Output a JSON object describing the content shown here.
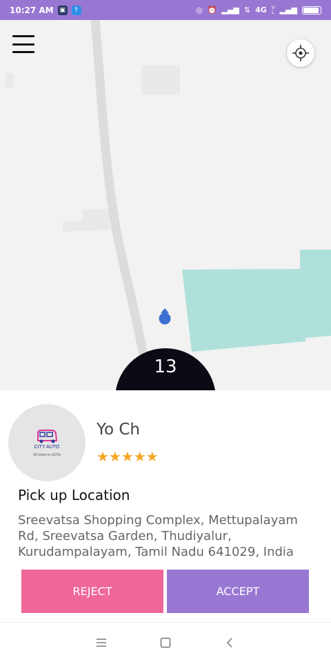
{
  "status_bar": {
    "time": "10:27 AM",
    "network": "4G",
    "colors": {
      "background": "#9877d3"
    }
  },
  "map": {
    "eta_value": "13",
    "colors": {
      "background": "#f2f2f2",
      "road": "#dcdcdc",
      "park": "#afe1da",
      "marker": "#3b6fd1"
    }
  },
  "driver": {
    "name": "Yo Ch",
    "rating": 5,
    "stars": "★★★★★",
    "logo_title": "CITY AUTO",
    "logo_tag": "All Votes to GOTo"
  },
  "pickup": {
    "title": "Pick up Location",
    "address": "Sreevatsa Shopping Complex, Mettupalayam Rd, Sreevatsa Garden, Thudiyalur, Kurudampalayam, Tamil Nadu 641029, India"
  },
  "actions": {
    "reject_label": "REJECT",
    "accept_label": "ACCEPT",
    "colors": {
      "reject": "#f0679a",
      "accept": "#9877d3"
    }
  },
  "nav_bar": {
    "icons": [
      "menu-icon",
      "home-icon",
      "back-icon"
    ]
  }
}
